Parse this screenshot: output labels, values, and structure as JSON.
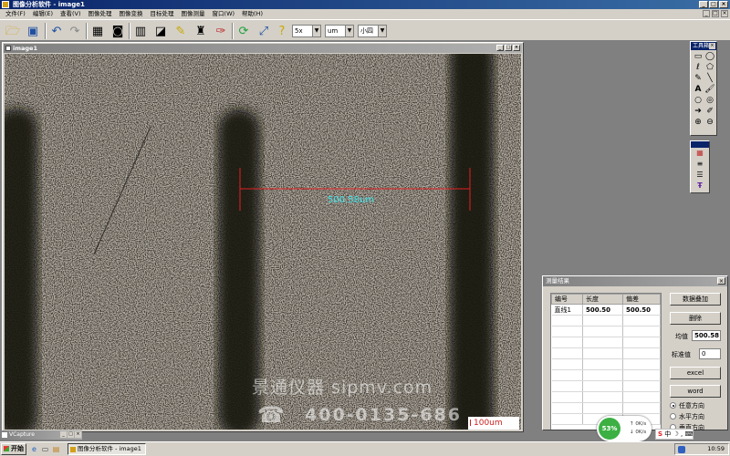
{
  "app": {
    "title": "图像分析软件 - image1",
    "controls": [
      "_",
      "□",
      "×"
    ]
  },
  "menu": {
    "items": [
      "文件(F)",
      "编辑(E)",
      "查看(V)",
      "图像处理",
      "图像变换",
      "目标处理",
      "图像测量",
      "窗口(W)",
      "帮助(H)"
    ],
    "mdi_controls": [
      "_",
      "□",
      "×"
    ]
  },
  "toolbar": {
    "magnification": "5x",
    "unit": "um",
    "font_size": "小四",
    "dropdown_arrow": "▼"
  },
  "image_window": {
    "title": "image1",
    "controls": [
      "_",
      "□",
      "×"
    ],
    "measurement_label": "500.58um",
    "scale_bar_label": "100um"
  },
  "watermark": {
    "line1": "景通仪器 sipmv.com",
    "line2": "400-0135-686"
  },
  "tools_palette": {
    "title": "工具箱",
    "close": "×"
  },
  "results_dialog": {
    "title": "测量结果",
    "close": "×",
    "columns": [
      "编号",
      "长度",
      "偏差"
    ],
    "rows": [
      {
        "id": "直线1",
        "length": "500.50",
        "deviation": "500.50"
      }
    ],
    "data_overlay_button": "数据叠加",
    "delete_button": "删除",
    "mean_label": "均值",
    "mean_value": "500.58",
    "std_label": "标准值",
    "std_value": "0",
    "excel_button": "excel",
    "word_button": "word",
    "direction_any": "任意方向",
    "direction_horizontal": "水平方向",
    "direction_vertical": "垂直方向"
  },
  "minimized_window": {
    "title": "VCapture",
    "controls": [
      "_",
      "□",
      "×"
    ]
  },
  "network_widget": {
    "percent": "53%",
    "up": "0K/s",
    "down": "0K/s"
  },
  "ime": {
    "logo": "S",
    "lang": "中"
  },
  "taskbar": {
    "start_label": "开始",
    "task_label": "图像分析软件 - image1",
    "clock": "10:59"
  },
  "colors": {
    "measure_line": "#e02020",
    "measure_label": "#3ee8ee",
    "title_active": "#0a246a"
  }
}
